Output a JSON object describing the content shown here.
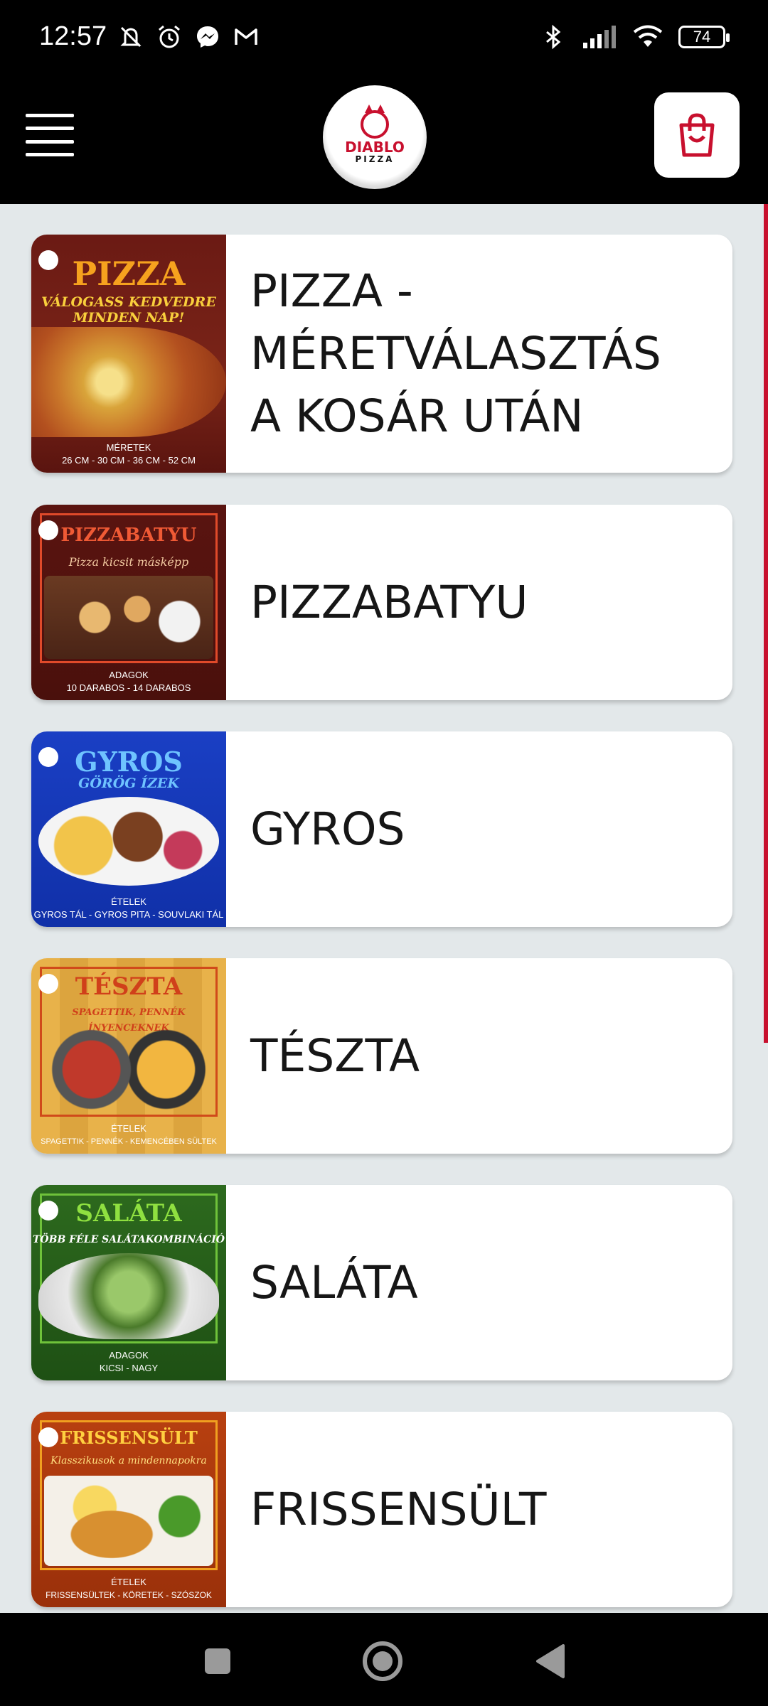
{
  "status_bar": {
    "time": "12:57",
    "battery": "74",
    "left_icons": [
      "mute-icon",
      "alarm-icon",
      "messenger-icon",
      "gmail-icon"
    ],
    "right_icons": [
      "bluetooth-icon",
      "signal-icon",
      "wifi-icon",
      "battery-icon"
    ]
  },
  "header": {
    "logo_text": "DIABLO",
    "logo_sub": "PIZZA",
    "menu_icon": "hamburger-icon",
    "cart_icon": "shopping-bag-icon"
  },
  "colors": {
    "brand_red": "#c8102e",
    "background": "#e3e8ea",
    "bar": "#000000"
  },
  "categories": [
    {
      "label": "PIZZA - MÉRETVÁLASZTÁS A KOSÁR UTÁN",
      "image_title": "PIZZA",
      "image_sub": "VÁLOGASS KEDVEDRE MINDEN NAP!",
      "image_foot_head": "MÉRETEK",
      "image_foot": "26 CM - 30 CM - 36 CM - 52 CM"
    },
    {
      "label": "PIZZABATYU",
      "image_title": "PIZZABATYU",
      "image_sub": "Pizza kicsit másképp",
      "image_foot_head": "ADAGOK",
      "image_foot": "10 DARABOS - 14 DARABOS"
    },
    {
      "label": "GYROS",
      "image_title": "GYROS",
      "image_sub": "GÖRÖG ÍZEK",
      "image_foot_head": "ÉTELEK",
      "image_foot": "GYROS TÁL - GYROS PITA - SOUVLAKI TÁL"
    },
    {
      "label": "TÉSZTA",
      "image_title": "TÉSZTA",
      "image_sub": "SPAGETTIK, PENNÉK ÍNYENCEKNEK",
      "image_foot_head": "ÉTELEK",
      "image_foot": "SPAGETTIK - PENNÉK - KEMENCÉBEN SÜLTEK"
    },
    {
      "label": "SALÁTA",
      "image_title": "SALÁTA",
      "image_sub": "TÖBB FÉLE SALÁTAKOMBINÁCIÓ",
      "image_foot_head": "ADAGOK",
      "image_foot": "KICSI - NAGY"
    },
    {
      "label": "FRISSENSÜLT",
      "image_title": "FRISSENSÜLT",
      "image_sub": "Klasszikusok a mindennapokra",
      "image_foot_head": "ÉTELEK",
      "image_foot": "FRISSENSÜLTEK - KÖRETEK - SZÓSZOK"
    }
  ],
  "nav": {
    "icons": [
      "recents-icon",
      "home-icon",
      "back-icon"
    ]
  }
}
